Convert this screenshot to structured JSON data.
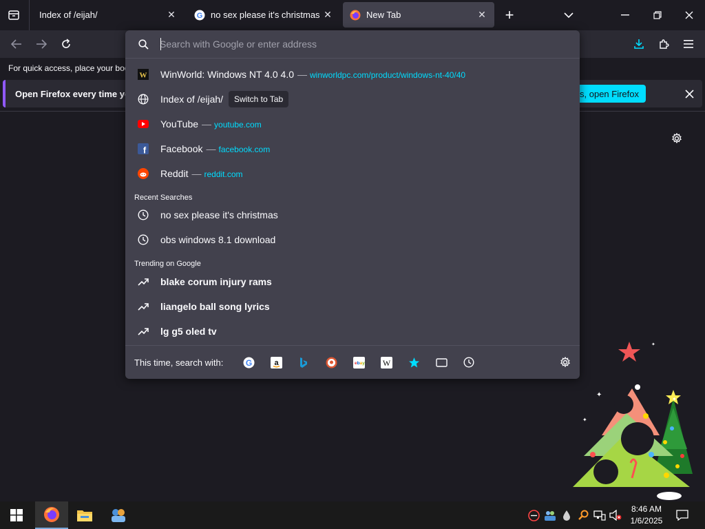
{
  "tabs": [
    {
      "title": "Index of /eijah/",
      "active": false,
      "favicon": "none"
    },
    {
      "title": "no sex please it's christmas - Go",
      "active": false,
      "favicon": "google-icon"
    },
    {
      "title": "New Tab",
      "active": true,
      "favicon": "firefox-icon"
    }
  ],
  "toolbar": {
    "bookmarks_hint": "For quick access, place your boo",
    "notice_text": "Open Firefox every time you",
    "notice_button": "es, open Firefox"
  },
  "urlbar": {
    "placeholder": "Search with Google or enter address",
    "results": [
      {
        "title": "WinWorld: Windows NT 4.0 4.0",
        "url": "winworldpc.com/product/windows-nt-40/40",
        "icon": "winworld-icon"
      },
      {
        "title": "Index of /eijah/",
        "url": "",
        "icon": "globe-icon",
        "action": "Switch to Tab"
      },
      {
        "title": "YouTube",
        "url": "youtube.com",
        "icon": "youtube-icon"
      },
      {
        "title": "Facebook",
        "url": "facebook.com",
        "icon": "facebook-icon"
      },
      {
        "title": "Reddit",
        "url": "reddit.com",
        "icon": "reddit-icon"
      }
    ],
    "recent_label": "Recent Searches",
    "recent": [
      "no sex please it's christmas",
      "obs windows 8.1 download"
    ],
    "trending_label": "Trending on Google",
    "trending": [
      "blake corum injury rams",
      "liangelo ball song lyrics",
      "lg g5 oled tv"
    ],
    "engines_label": "This time, search with:",
    "engines": [
      "google-icon",
      "amazon-icon",
      "bing-icon",
      "duckduckgo-icon",
      "ebay-icon",
      "wikipedia-icon",
      "bookmarks-star-icon",
      "tabs-icon",
      "history-icon"
    ]
  },
  "taskbar": {
    "time": "8:46 AM",
    "date": "1/6/2025"
  },
  "colors": {
    "accent": "#00ddff",
    "panel": "#42414d",
    "background": "#1c1b22"
  }
}
